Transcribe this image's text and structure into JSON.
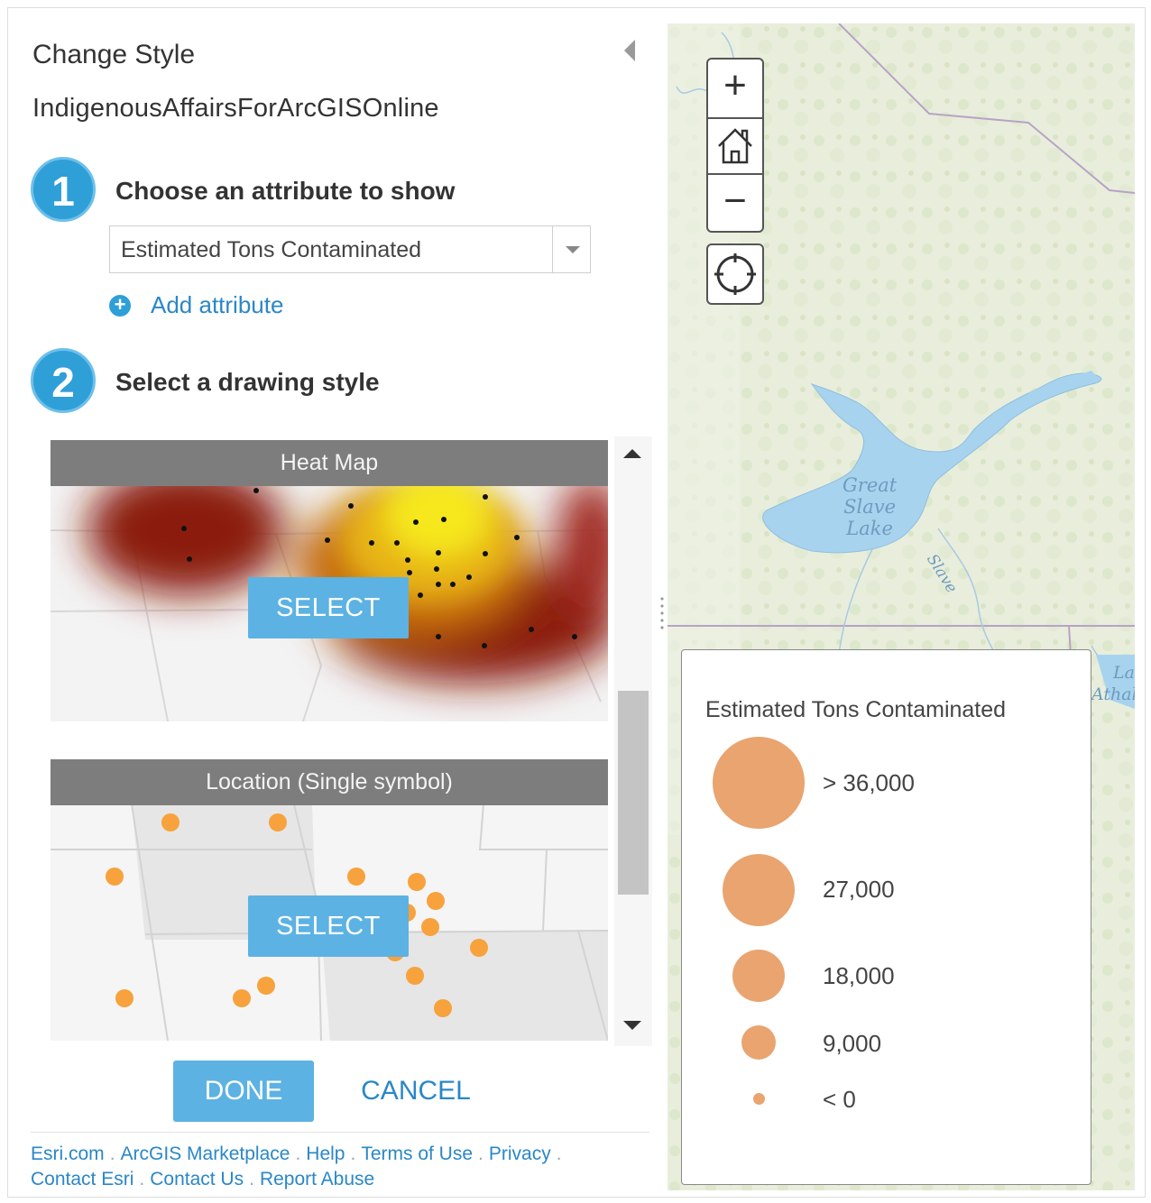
{
  "panel": {
    "title": "Change Style",
    "layer_name": "IndigenousAffairsForArcGISOnline",
    "step1": {
      "number": "1",
      "text": "Choose an attribute to show"
    },
    "attribute_select": {
      "value": "Estimated Tons Contaminated"
    },
    "add_attribute_label": "Add attribute",
    "step2": {
      "number": "2",
      "text": "Select a drawing style"
    },
    "styles": [
      {
        "title": "Heat Map",
        "button": "SELECT"
      },
      {
        "title": "Location (Single symbol)",
        "button": "SELECT"
      }
    ],
    "done_label": "DONE",
    "cancel_label": "CANCEL"
  },
  "footer": {
    "links": [
      "Esri.com",
      "ArcGIS Marketplace",
      "Help",
      "Terms of Use",
      "Privacy",
      "Contact Esri",
      "Contact Us",
      "Report Abuse"
    ]
  },
  "map": {
    "lake_label": [
      "Great",
      "Slave",
      "Lake"
    ],
    "river_label": "Slave",
    "edge_label": [
      "La",
      "Athal"
    ],
    "controls": {
      "zoom_in": "+",
      "zoom_out": "−"
    }
  },
  "legend": {
    "title": "Estimated Tons Contaminated",
    "items": [
      {
        "label": "> 36,000"
      },
      {
        "label": "27,000"
      },
      {
        "label": "18,000"
      },
      {
        "label": "9,000"
      },
      {
        "label": "< 0"
      }
    ],
    "symbol_color": "#e9a46f"
  },
  "colors": {
    "accent": "#5cb2e3",
    "step_badge": "#2f9fd8",
    "link": "#2a87c8",
    "heat_low": "#8b1a10",
    "heat_high": "#f2e21a",
    "location_point": "#f7a23c"
  }
}
